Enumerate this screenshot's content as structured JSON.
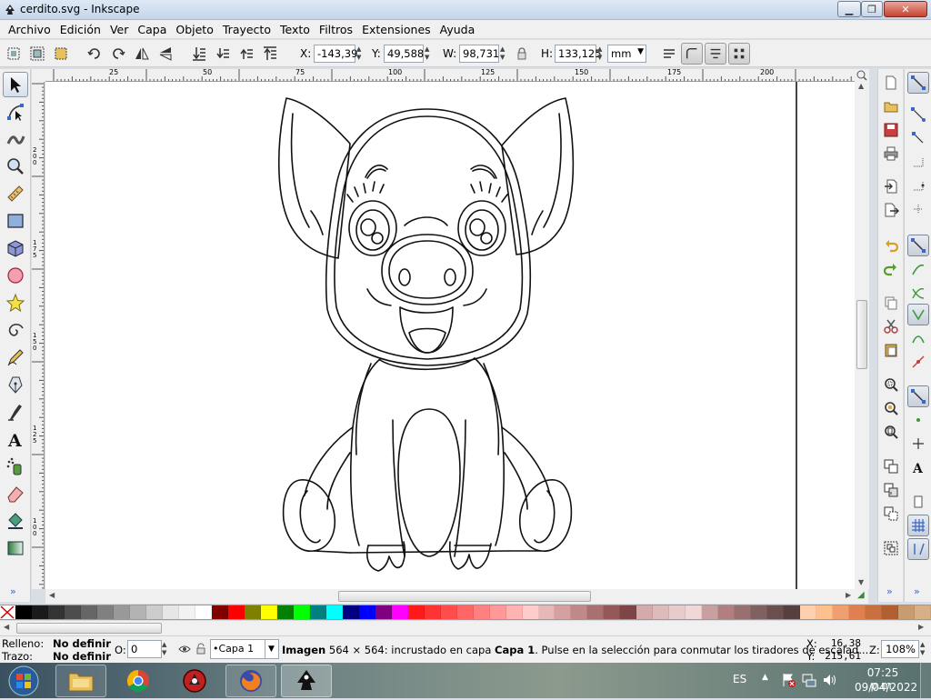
{
  "window": {
    "title": "cerdito.svg - Inkscape",
    "minimize": "▁",
    "maximize": "❐",
    "close": "✕"
  },
  "menu": [
    "Archivo",
    "Edición",
    "Ver",
    "Capa",
    "Objeto",
    "Trayecto",
    "Texto",
    "Filtros",
    "Extensiones",
    "Ayuda"
  ],
  "controls": {
    "x_label": "X:",
    "x_value": "-143,39",
    "y_label": "Y:",
    "y_value": "49,588",
    "w_label": "W:",
    "w_value": "98,731",
    "h_label": "H:",
    "h_value": "133,125",
    "unit": "mm"
  },
  "ruler": {
    "h_labels": [
      "25",
      "50",
      "75",
      "100",
      "125",
      "150",
      "175",
      "200"
    ],
    "v_labels": [
      "200",
      "175",
      "150",
      "125",
      "100"
    ]
  },
  "left_tools": [
    "selector-icon",
    "node-icon",
    "tweak-icon",
    "zoom-icon",
    "measure-icon",
    "rectangle-icon",
    "3d-box-icon",
    "ellipse-icon",
    "star-icon",
    "spiral-icon",
    "pencil-icon",
    "pen-icon",
    "calligraphy-icon",
    "text-icon",
    "spray-icon",
    "eraser-icon",
    "paint-bucket-icon",
    "gradient-icon"
  ],
  "palette": {
    "colors": [
      "#000000",
      "#1a1a1a",
      "#333333",
      "#4d4d4d",
      "#666666",
      "#808080",
      "#999999",
      "#b3b3b3",
      "#cccccc",
      "#e6e6e6",
      "#f2f2f2",
      "#ffffff",
      "#800000",
      "#ff0000",
      "#808000",
      "#ffff00",
      "#008000",
      "#00ff00",
      "#008080",
      "#00ffff",
      "#000080",
      "#0000ff",
      "#800080",
      "#ff00ff",
      "#ff1a1a",
      "#ff3333",
      "#ff4d4d",
      "#ff6666",
      "#ff8080",
      "#ff9999",
      "#ffb3b3",
      "#ffcccc",
      "#e6b8b8",
      "#d4a0a0",
      "#c08888",
      "#a87070",
      "#955757",
      "#7d4545",
      "#d4aaaa",
      "#ddbbbb",
      "#e8cccc",
      "#f0d8d8",
      "#c8a0a0",
      "#b08080",
      "#987070",
      "#806060",
      "#6b4f4f",
      "#563f3f",
      "#ffd0b0",
      "#ffc090",
      "#f0a070",
      "#e08050",
      "#c87040",
      "#b06030",
      "#c89c70",
      "#d8b088"
    ]
  },
  "status": {
    "fill_label": "Relleno:",
    "fill_value": "No definir",
    "stroke_label": "Trazo:",
    "stroke_value": "No definir",
    "opacity_label": "O:",
    "opacity_value": "0",
    "layer": "•Capa 1",
    "message_bold": "Imagen",
    "message_1": " 564 × 564: incrustado en capa ",
    "message_layer": "Capa 1",
    "message_2": ". Pulse en la selección para conmutar los tiradores de escalad...",
    "cursor_x_label": "X:",
    "cursor_x": "16,38",
    "cursor_y_label": "Y:",
    "cursor_y": "215,61",
    "zoom_label": "Z:",
    "zoom": "108%"
  },
  "taskbar": {
    "language": "ES",
    "time": "07:25 p.m.",
    "date": "09/04/2022",
    "apps": [
      "start-orb-icon",
      "file-explorer-icon",
      "chrome-icon",
      "red-app-icon",
      "firefox-icon",
      "inkscape-icon"
    ]
  },
  "colors": {
    "titlebar": "#c4d5ea",
    "chrome_bg": "#f0f0f0",
    "canvas": "#ffffff"
  }
}
